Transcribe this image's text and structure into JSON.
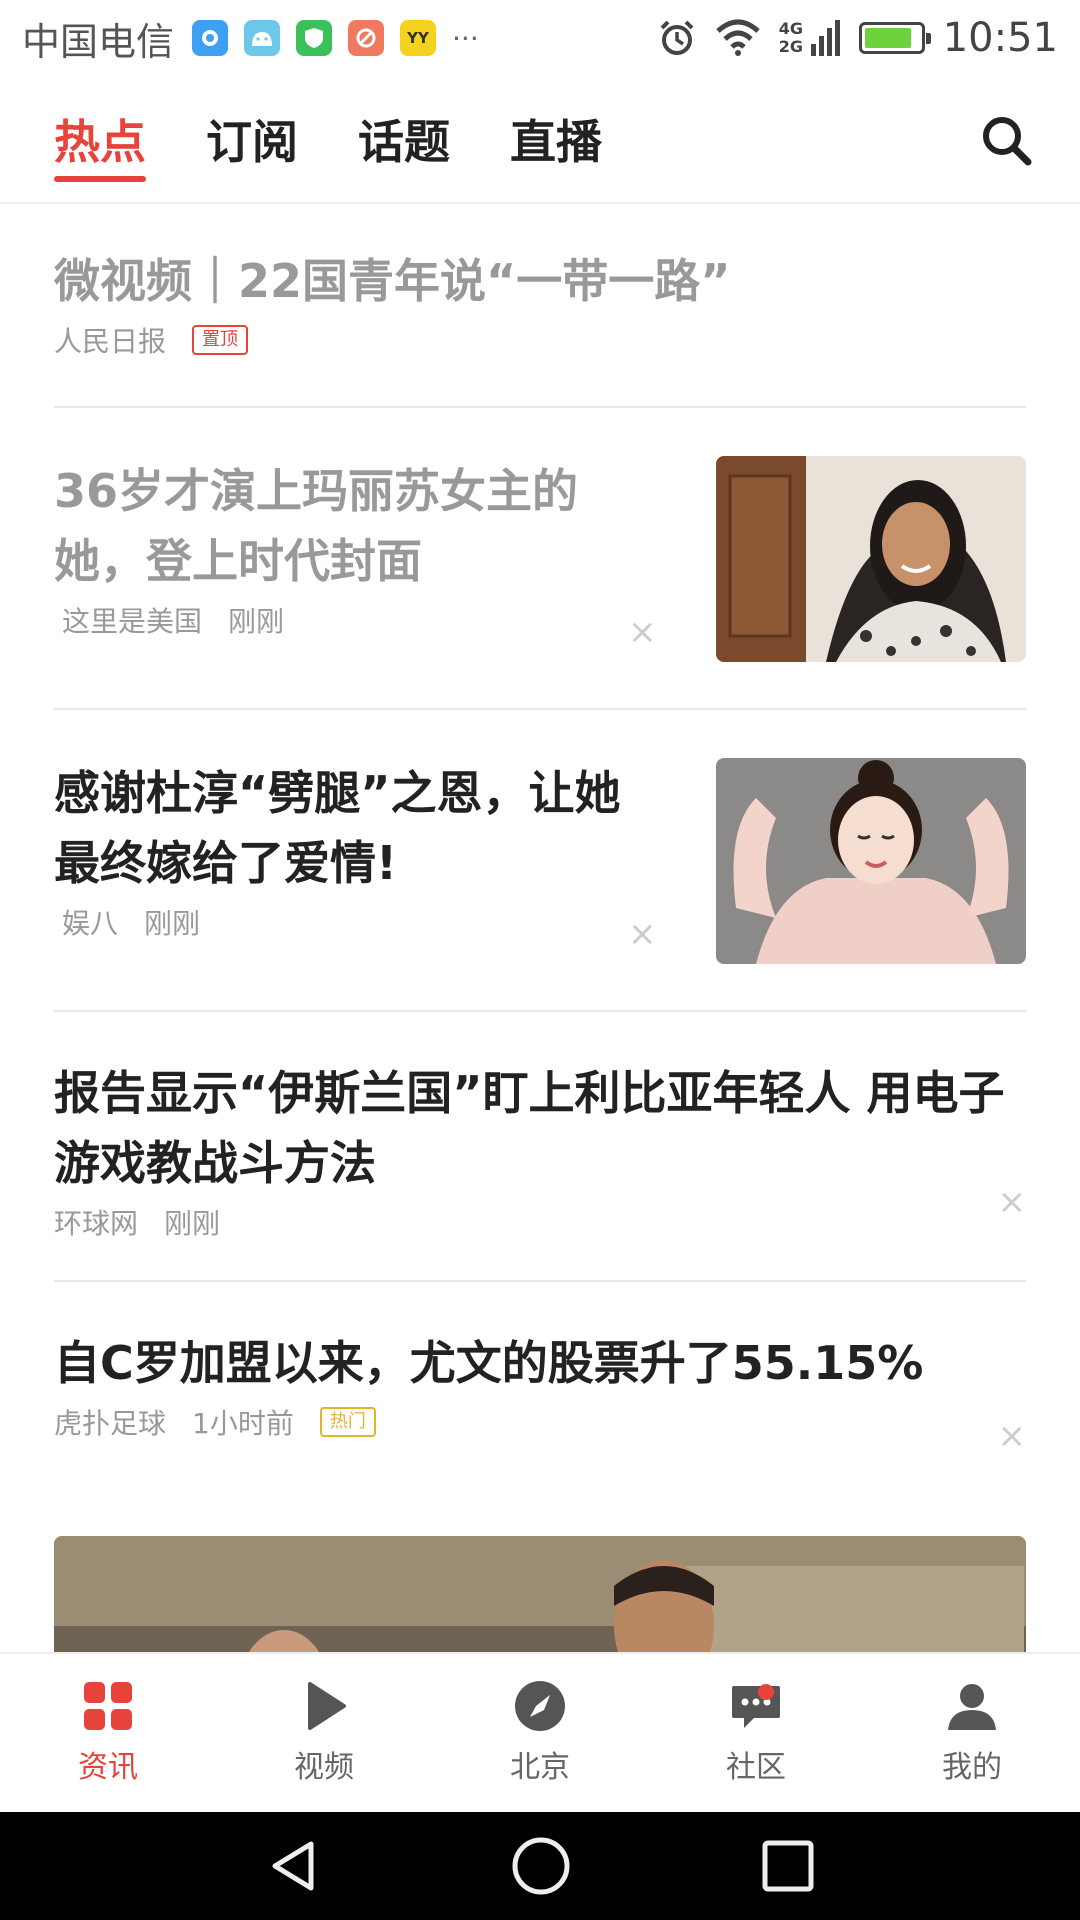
{
  "status_bar": {
    "carrier": "中国电信",
    "time": "10:51",
    "network": "4G 2G",
    "notifications": [
      "maps-icon",
      "android-icon",
      "shield-icon",
      "tools-icon",
      "yy-icon"
    ],
    "more": "···",
    "battery_level": 0.85
  },
  "tabs": [
    {
      "label": "热点",
      "active": true
    },
    {
      "label": "订阅"
    },
    {
      "label": "话题"
    },
    {
      "label": "直播"
    }
  ],
  "feed": [
    {
      "title": "微视频｜22国青年说“一带一路”",
      "source": "人民日报",
      "tag": "置顶"
    },
    {
      "title": "36岁才演上玛丽苏女主的她，登上时代封面",
      "source": "这里是美国",
      "time": "刚刚",
      "close": "×"
    },
    {
      "title": "感谢杜淳“劈腿”之恩，让她最终嫁给了爱情!",
      "source": "娱八",
      "time": "刚刚",
      "close": "×"
    },
    {
      "title": "报告显示“伊斯兰国”盯上利比亚年轻人 用电子游戏教战斗方法",
      "source": "环球网",
      "time": "刚刚",
      "close": "×"
    },
    {
      "title": "自C罗加盟以来，尤文的股票升了55.15%",
      "source": "虎扑足球",
      "time": "1小时前",
      "tag": "热门",
      "close": "×"
    }
  ],
  "bottom_nav": [
    {
      "label": "资讯",
      "icon": "grid-icon",
      "active": true
    },
    {
      "label": "视频",
      "icon": "play-icon"
    },
    {
      "label": "北京",
      "icon": "compass-icon"
    },
    {
      "label": "社区",
      "icon": "chat-icon",
      "badge": true
    },
    {
      "label": "我的",
      "icon": "user-icon"
    }
  ],
  "colors": {
    "accent": "#e8433b",
    "hot_tag": "#e8b22a"
  }
}
